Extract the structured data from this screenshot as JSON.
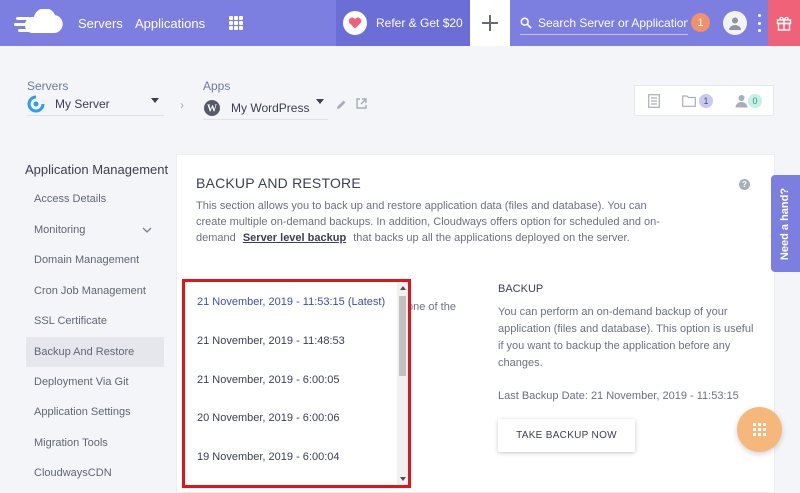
{
  "topbar": {
    "nav": [
      "Servers",
      "Applications"
    ],
    "refer_label": "Refer & Get $20",
    "search_placeholder": "Search Server or Application",
    "notification_count": "1",
    "colors": {
      "bar": "#7c7fe0",
      "refer": "#6b6ed6",
      "badge": "#f2906a",
      "gift": "#f06277"
    }
  },
  "breadcrumb": {
    "servers_label": "Servers",
    "server_name": "My Server",
    "apps_label": "Apps",
    "app_name": "My WordPress",
    "tools": {
      "folder_count": "1",
      "users_count": "0"
    }
  },
  "sidebar": {
    "title": "Application Management",
    "items": [
      {
        "label": "Access Details"
      },
      {
        "label": "Monitoring"
      },
      {
        "label": "Domain Management"
      },
      {
        "label": "Cron Job Management"
      },
      {
        "label": "SSL Certificate"
      },
      {
        "label": "Backup And Restore"
      },
      {
        "label": "Deployment Via Git"
      },
      {
        "label": "Application Settings"
      },
      {
        "label": "Migration Tools"
      },
      {
        "label": "CloudwaysCDN"
      }
    ],
    "active_item": "Backup And Restore"
  },
  "panel": {
    "title": "BACKUP AND RESTORE",
    "desc_before": "This section allows you to back up and restore application data (files and database). You can create multiple on-demand backups. In addition, Cloudways offers option for scheduled and on-demand",
    "desc_link": "Server level backup",
    "desc_after": "that backs up all the applications deployed on the server.",
    "restore_hint": "one of the",
    "backup_heading": "BACKUP",
    "backup_text": "You can perform an on-demand backup of your application (files and database). This option is useful if you want to backup the application before any changes.",
    "last_backup": "Last Backup Date: 21 November, 2019 - 11:53:15",
    "take_backup_label": "TAKE BACKUP NOW"
  },
  "backup_list": [
    {
      "label": "21 November, 2019 - 11:53:15 (Latest)"
    },
    {
      "label": "21 November, 2019 - 11:48:53"
    },
    {
      "label": "21 November, 2019 - 6:00:05"
    },
    {
      "label": "20 November, 2019 - 6:00:06"
    },
    {
      "label": "19 November, 2019 - 6:00:04"
    }
  ],
  "help_tab_label": "Need a hand?"
}
